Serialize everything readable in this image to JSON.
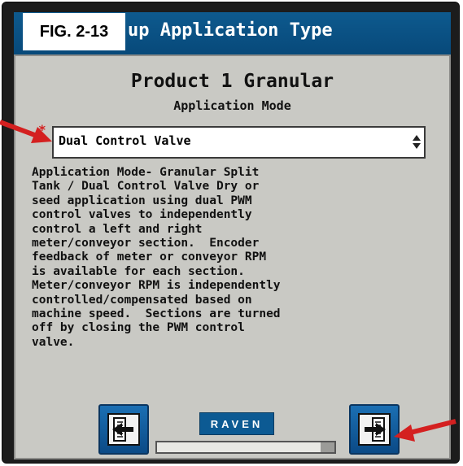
{
  "figure_label": "FIG. 2-13",
  "window": {
    "title_visible": "up Application Type"
  },
  "panel": {
    "heading": "Product 1 Granular",
    "subheading": "Application Mode",
    "required_marker": "*",
    "mode_select": {
      "value": "Dual Control Valve"
    },
    "description": "Application Mode- Granular Split\nTank / Dual Control Valve Dry or\nseed application using dual PWM\ncontrol valves to independently\ncontrol a left and right\nmeter/conveyor section.  Encoder\nfeedback of meter or conveyor RPM\nis available for each section.\nMeter/conveyor RPM is independently\ncontrolled/compensated based on\nmachine speed.  Sections are turned\noff by closing the PWM control\nvalve."
  },
  "footer": {
    "brand": "RAVEN",
    "back_icon": "back-arrow-icon",
    "next_icon": "next-arrow-icon",
    "progress_fraction": 0.92
  },
  "colors": {
    "title_bar": "#07497a",
    "panel_bg": "#c9c9c4",
    "button_blue": "#0b4a86",
    "annotation_red": "#d42020"
  }
}
